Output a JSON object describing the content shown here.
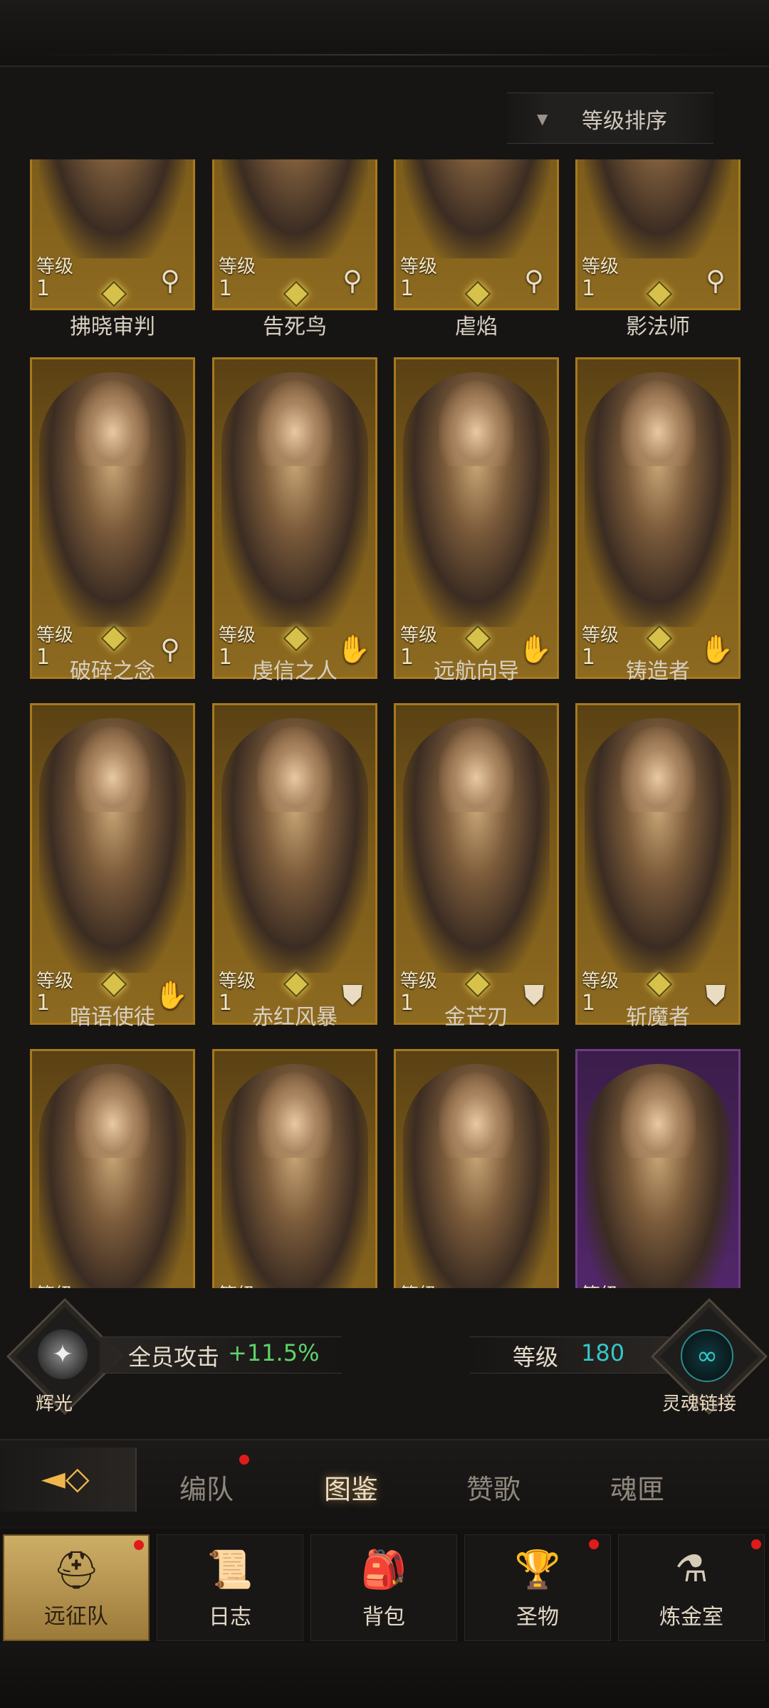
{
  "sort": {
    "label": "等级排序",
    "icon": "triangle-down-icon"
  },
  "level_label": "等级",
  "level_value": "1",
  "heroes": [
    {
      "name": "拂晓审判",
      "class_icon": "wand-icon"
    },
    {
      "name": "告死鸟",
      "class_icon": "wand-icon"
    },
    {
      "name": "虐焰",
      "class_icon": "wand-icon"
    },
    {
      "name": "影法师",
      "class_icon": "wand-icon"
    },
    {
      "name": "破碎之念",
      "class_icon": "wand-icon"
    },
    {
      "name": "虔信之人",
      "class_icon": "palm-icon"
    },
    {
      "name": "远航向导",
      "class_icon": "palm-icon"
    },
    {
      "name": "铸造者",
      "class_icon": "palm-icon"
    },
    {
      "name": "暗语使徒",
      "class_icon": "palm-icon"
    },
    {
      "name": "赤红风暴",
      "class_icon": "shield-icon"
    },
    {
      "name": "金芒刃",
      "class_icon": "shield-icon"
    },
    {
      "name": "斩魔者",
      "class_icon": "shield-icon"
    }
  ],
  "partial_row": [
    {
      "label": "等级",
      "frame": "gold"
    },
    {
      "label": "等级",
      "frame": "gold"
    },
    {
      "label": "等级",
      "frame": "gold"
    },
    {
      "label": "等级",
      "frame": "purple"
    }
  ],
  "stats": {
    "glow_label": "辉光",
    "attack_label": "全员攻击",
    "attack_value": "+11.5%",
    "level_label": "等级",
    "level_value": "180",
    "soul_link_label": "灵魂链接"
  },
  "tabs": [
    {
      "label": "编队",
      "notify": true
    },
    {
      "label": "图鉴",
      "active": true
    },
    {
      "label": "赞歌"
    },
    {
      "label": "魂匣"
    }
  ],
  "nav": [
    {
      "label": "远征队",
      "icon": "helmet-icon",
      "active": true,
      "notify": true
    },
    {
      "label": "日志",
      "icon": "scroll-icon"
    },
    {
      "label": "背包",
      "icon": "bag-icon"
    },
    {
      "label": "圣物",
      "icon": "chalice-icon",
      "notify": true
    },
    {
      "label": "炼金室",
      "icon": "alchemy-icon",
      "notify": true
    }
  ],
  "colors": {
    "gold_frame": "#a7791d",
    "purple_frame": "#6f3a86",
    "attack_green": "#5fd36a",
    "level_teal": "#35c7c7",
    "notify_red": "#e01b1b"
  }
}
